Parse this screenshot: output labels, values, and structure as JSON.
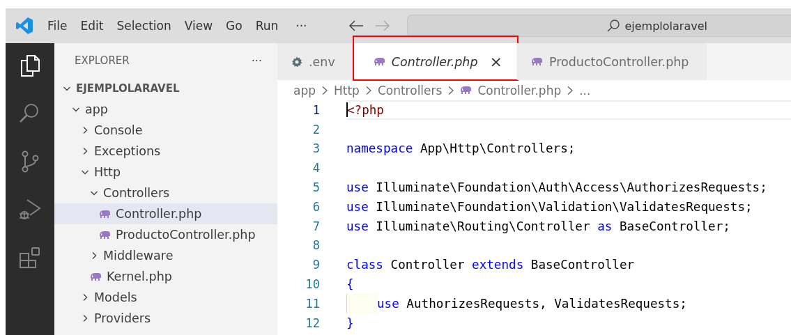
{
  "title_bar": {
    "menu": [
      {
        "label": "File"
      },
      {
        "label": "Edit"
      },
      {
        "label": "Selection"
      },
      {
        "label": "View"
      },
      {
        "label": "Go"
      },
      {
        "label": "Run"
      }
    ],
    "more": "···",
    "back_disabled": false,
    "forward_disabled": true,
    "search": {
      "value": "ejemplolaravel"
    }
  },
  "activity_bar": [
    {
      "kind": "explorer",
      "selected": true
    },
    {
      "kind": "search",
      "selected": false
    },
    {
      "kind": "source-control",
      "selected": false
    },
    {
      "kind": "run-debug",
      "selected": false
    },
    {
      "kind": "extensions",
      "selected": false
    }
  ],
  "explorer": {
    "title": "EXPLORER",
    "more": "···",
    "tree": {
      "label": "EJEMPLOLARAVEL",
      "kind": "folder",
      "expanded": true,
      "selected": false,
      "children": [
        {
          "label": "app",
          "kind": "folder",
          "expanded": true,
          "selected": false,
          "children": [
            {
              "label": "Console",
              "kind": "folder",
              "expanded": false,
              "selected": false
            },
            {
              "label": "Exceptions",
              "kind": "folder",
              "expanded": false,
              "selected": false
            },
            {
              "label": "Http",
              "kind": "folder",
              "expanded": true,
              "selected": false,
              "children": [
                {
                  "label": "Controllers",
                  "kind": "folder",
                  "expanded": true,
                  "selected": false,
                  "children": [
                    {
                      "label": "Controller.php",
                      "kind": "file",
                      "selected": true
                    },
                    {
                      "label": "ProductoController.php",
                      "kind": "file",
                      "selected": false
                    }
                  ]
                },
                {
                  "label": "Middleware",
                  "kind": "folder",
                  "expanded": false,
                  "selected": false
                },
                {
                  "label": "Kernel.php",
                  "kind": "file",
                  "selected": false
                }
              ]
            },
            {
              "label": "Models",
              "kind": "folder",
              "expanded": false,
              "selected": false
            },
            {
              "label": "Providers",
              "kind": "folder",
              "expanded": false,
              "selected": false
            }
          ]
        }
      ]
    }
  },
  "tabs": [
    {
      "label": ".env",
      "kind": "settings",
      "selected": false,
      "preview": false,
      "highlighted": false
    },
    {
      "label": "Controller.php",
      "kind": "php",
      "selected": true,
      "preview": true,
      "highlighted": true,
      "close": "×"
    },
    {
      "label": "ProductoController.php",
      "kind": "php",
      "selected": false,
      "preview": false,
      "highlighted": false
    }
  ],
  "breadcrumb": [
    {
      "label": "app",
      "kind": "folder"
    },
    {
      "label": "Http",
      "kind": "folder"
    },
    {
      "label": "Controllers",
      "kind": "folder"
    },
    {
      "label": "Controller.php",
      "kind": "php"
    },
    {
      "label": "...",
      "kind": "symbol"
    }
  ],
  "code": [
    {
      "number": "1",
      "current": true,
      "indented": false,
      "tokens": [
        {
          "kind": "tag",
          "text": "<?php"
        }
      ]
    },
    {
      "number": "2",
      "current": false,
      "indented": false
    },
    {
      "number": "3",
      "current": false,
      "indented": false,
      "tokens": [
        {
          "kind": "keyword",
          "text": "namespace"
        },
        {
          "kind": "plain",
          "text": " App\\Http\\Controllers;"
        }
      ]
    },
    {
      "number": "4",
      "current": false,
      "indented": false
    },
    {
      "number": "5",
      "current": false,
      "indented": false,
      "tokens": [
        {
          "kind": "keyword",
          "text": "use"
        },
        {
          "kind": "plain",
          "text": " Illuminate\\Foundation\\Auth\\Access\\AuthorizesRequests;"
        }
      ]
    },
    {
      "number": "6",
      "current": false,
      "indented": false,
      "tokens": [
        {
          "kind": "keyword",
          "text": "use"
        },
        {
          "kind": "plain",
          "text": " Illuminate\\Foundation\\Validation\\ValidatesRequests;"
        }
      ]
    },
    {
      "number": "7",
      "current": false,
      "indented": false,
      "tokens": [
        {
          "kind": "keyword",
          "text": "use"
        },
        {
          "kind": "plain",
          "text": " Illuminate\\Routing\\Controller "
        },
        {
          "kind": "keyword",
          "text": "as"
        },
        {
          "kind": "plain",
          "text": " BaseController;"
        }
      ]
    },
    {
      "number": "8",
      "current": false,
      "indented": false
    },
    {
      "number": "9",
      "current": false,
      "indented": false,
      "tokens": [
        {
          "kind": "keyword",
          "text": "class"
        },
        {
          "kind": "plain",
          "text": " Controller "
        },
        {
          "kind": "keyword",
          "text": "extends"
        },
        {
          "kind": "plain",
          "text": " BaseController"
        }
      ]
    },
    {
      "number": "10",
      "current": false,
      "indented": false,
      "tokens": [
        {
          "kind": "keyword",
          "text": "{"
        }
      ]
    },
    {
      "number": "11",
      "current": false,
      "indented": true,
      "tokens": [
        {
          "kind": "keyword",
          "text": "use"
        },
        {
          "kind": "plain",
          "text": " AuthorizesRequests, ValidatesRequests;"
        }
      ]
    },
    {
      "number": "12",
      "current": false,
      "indented": false,
      "tokens": [
        {
          "kind": "keyword",
          "text": "}"
        }
      ]
    }
  ]
}
